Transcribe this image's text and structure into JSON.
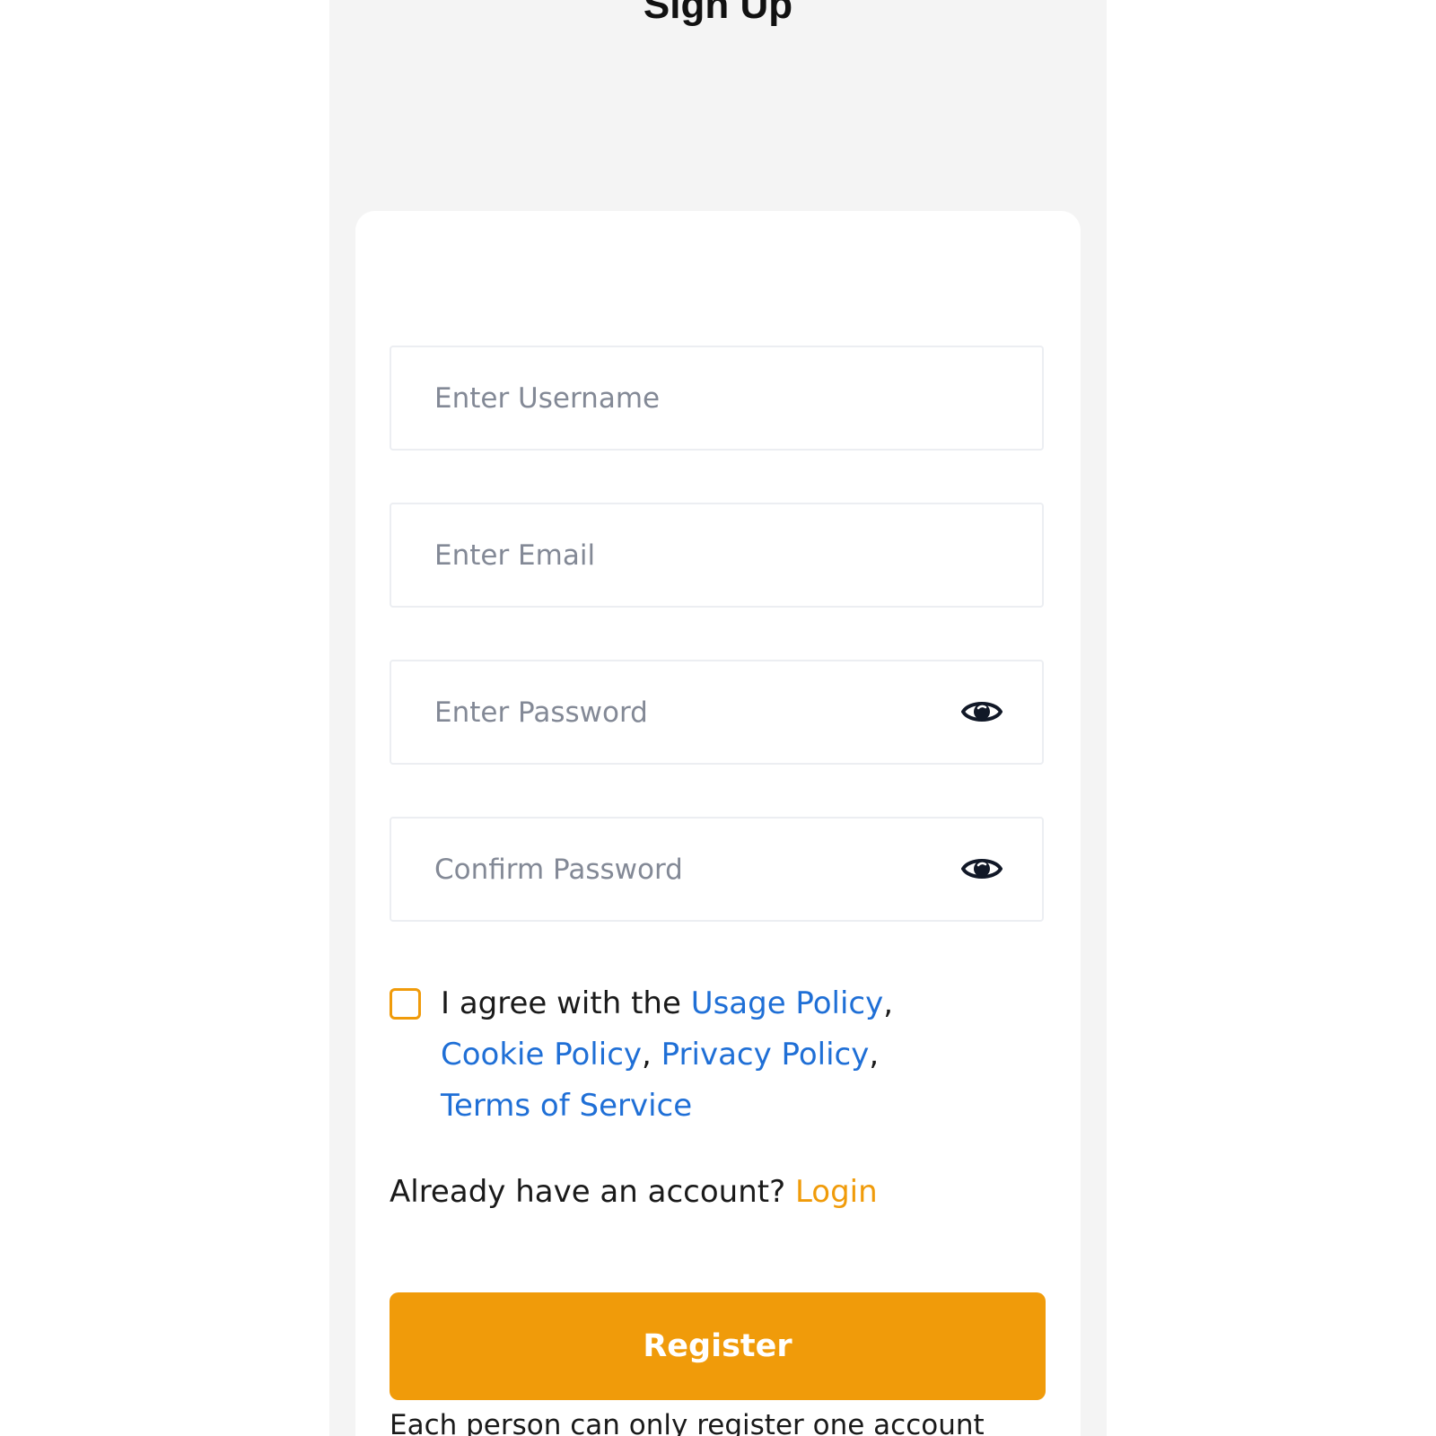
{
  "page": {
    "title": "Sign Up"
  },
  "form": {
    "username_placeholder": "Enter Username",
    "email_placeholder": "Enter Email",
    "password_placeholder": "Enter Password",
    "confirm_password_placeholder": "Confirm Password",
    "password_toggle_icon": "eye-icon",
    "agreement": {
      "checked": false,
      "prefix": "I agree with the ",
      "usage_policy": "Usage Policy",
      "cookie_policy": "Cookie Policy",
      "privacy_policy": "Privacy Policy",
      "terms_of_service": "Terms of Service",
      "separator": ","
    },
    "login_prompt": "Already have an account?",
    "login_link": "Login",
    "register_label": "Register",
    "note": "Each person can only register one account"
  },
  "colors": {
    "accent": "#f09b0a",
    "link": "#1f6fd6",
    "background": "#f4f4f4",
    "card": "#ffffff",
    "placeholder": "#838996"
  }
}
